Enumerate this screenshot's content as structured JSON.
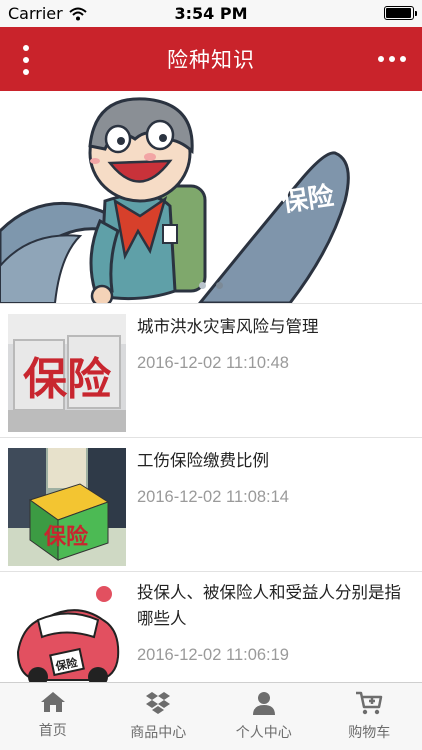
{
  "status_bar": {
    "carrier": "Carrier",
    "time": "3:54 PM",
    "battery_level": 0.95
  },
  "header": {
    "title": "险种知识",
    "left_icon": "vertical-dots-icon",
    "right_icon": "more-horizontal-icon",
    "background_color": "#c9232b"
  },
  "banner": {
    "image_text": "保险",
    "page_count": 2,
    "active_page": 1
  },
  "news": [
    {
      "title": "城市洪水灾害风险与管理",
      "date": "2016-12-02 11:10:48",
      "thumb_text": "保险"
    },
    {
      "title": "工伤保险缴费比例",
      "date": "2016-12-02 11:08:14",
      "thumb_text": "保险"
    },
    {
      "title": "投保人、被保险人和受益人分别是指哪些人",
      "date": "2016-12-02 11:06:19",
      "thumb_text": "保险"
    }
  ],
  "tab_bar": {
    "items": [
      {
        "label": "首页",
        "icon": "home-icon"
      },
      {
        "label": "商品中心",
        "icon": "dropbox-icon"
      },
      {
        "label": "个人中心",
        "icon": "user-icon"
      },
      {
        "label": "购物车",
        "icon": "cart-icon"
      }
    ]
  }
}
